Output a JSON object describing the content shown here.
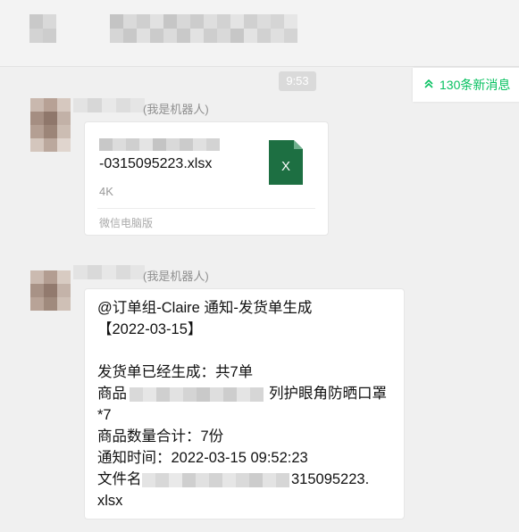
{
  "chat": {
    "time_divider": "9:53",
    "new_messages_label": "130条新消息",
    "new_messages_icon": "double-chevron-up-icon"
  },
  "messages": [
    {
      "sender_suffix": "(我是机器人)",
      "type": "file",
      "file_name": "-0315095223.xlsx",
      "file_size": "4K",
      "source": "微信电脑版",
      "file_icon": "excel-icon",
      "file_icon_letter": "X",
      "file_icon_color": "#1d6f42"
    },
    {
      "sender_suffix": "(我是机器人)",
      "type": "text",
      "lines": {
        "l1": "@订单组-Claire 通知-发货单生成",
        "l2": "【2022-03-15】",
        "l3": "发货单已经生成：共7单",
        "l4a": "商品",
        "l4b": "列护眼角防晒口罩",
        "l5": "*7",
        "l6": "商品数量合计：7份",
        "l7": "通知时间：2022-03-15 09:52:23",
        "l8a": "文件名",
        "l8b": "315095223.",
        "l9": "xlsx"
      }
    }
  ]
}
